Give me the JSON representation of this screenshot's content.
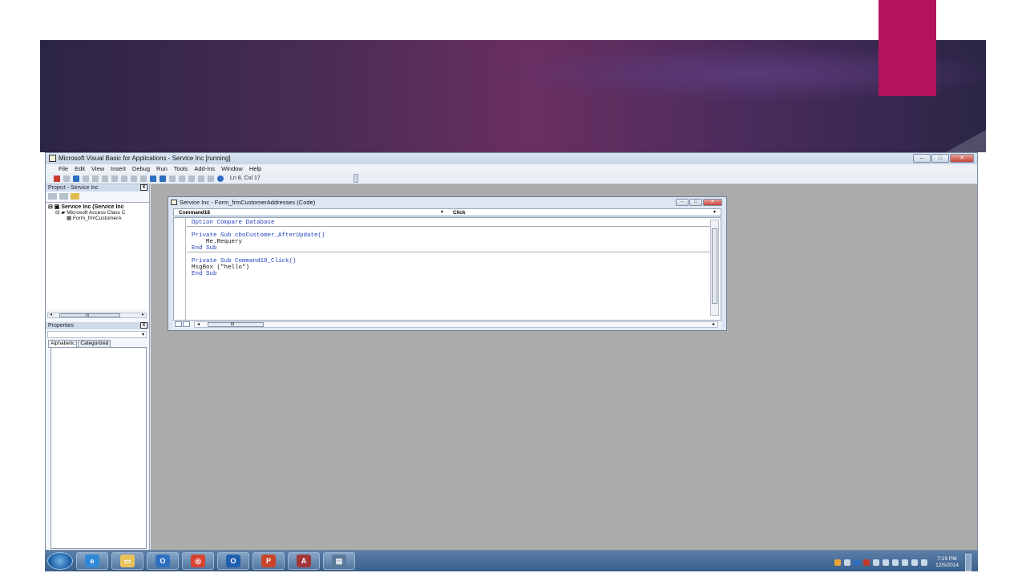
{
  "app": {
    "title": "Microsoft Visual Basic for Applications - Service Inc [running]",
    "window_buttons": [
      "–",
      "□",
      "✕"
    ]
  },
  "menu": [
    "File",
    "Edit",
    "View",
    "Insert",
    "Debug",
    "Run",
    "Tools",
    "Add-Ins",
    "Window",
    "Help"
  ],
  "toolbar": {
    "position_label": "Ln 8, Col 17"
  },
  "project_panel": {
    "title": "Project - Service Inc",
    "close_label": "x",
    "tree": {
      "root": "Service Inc (Service Inc",
      "folder": "Microsoft Access Class C",
      "item": "Form_frmCustomerA"
    },
    "scroll_label": "III"
  },
  "properties_panel": {
    "title": "Properties",
    "close_label": "x",
    "tabs": [
      "Alphabetic",
      "Categorized"
    ]
  },
  "code_window": {
    "title": "Service Inc - Form_frmCustomerAddresses (Code)",
    "object_combo": "Command18",
    "procedure_combo": "Click",
    "lines": {
      "l1": "Option Compare Database",
      "l2": "Private Sub cboCustomer_AfterUpdate()",
      "l3": "    Me.Requery",
      "l4": "End Sub",
      "l5": "Private Sub Command18_Click()",
      "l6": "MsgBox (\"hello\")",
      "l7": "End Sub"
    },
    "scroll_label": "III"
  },
  "taskbar": {
    "apps": [
      {
        "name": "internet-explorer",
        "glyph": "e",
        "color": "#2f89d8"
      },
      {
        "name": "file-explorer",
        "glyph": "▭",
        "color": "#e8c35a"
      },
      {
        "name": "outlook-calendar",
        "glyph": "O",
        "color": "#2d6fc0"
      },
      {
        "name": "chrome",
        "glyph": "◎",
        "color": "#d6432f"
      },
      {
        "name": "outlook",
        "glyph": "O",
        "color": "#1f5fb0"
      },
      {
        "name": "powerpoint",
        "glyph": "P",
        "color": "#c8442a"
      },
      {
        "name": "access",
        "glyph": "A",
        "color": "#a4373a"
      },
      {
        "name": "vba-editor",
        "glyph": "▤",
        "color": "#5a7a9a"
      }
    ],
    "clock_time": "7:19 PM",
    "clock_date": "12/5/2014"
  },
  "colors": {
    "slide_accent": "#b5135f",
    "keyword": "#1f3fbf",
    "mdi_background": "#ababab"
  }
}
